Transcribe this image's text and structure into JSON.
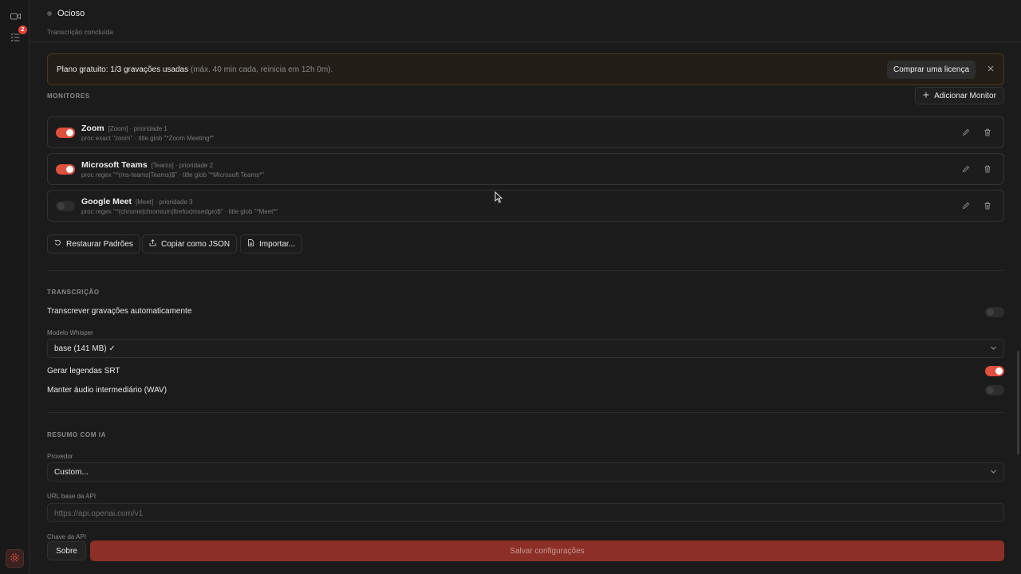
{
  "status": {
    "title": "Ocioso",
    "subtitle": "Transcrição concluída"
  },
  "sidebar": {
    "badge_count": "2",
    "accent": "#e0503e"
  },
  "banner": {
    "bold": "Plano gratuito: 1/3 gravações usadas",
    "muted": " (máx. 40 min cada, reinicia em 12h 0m).",
    "buy_label": "Comprar uma licença"
  },
  "monitors": {
    "section_label": "MONITORES",
    "add_label": "Adicionar Monitor",
    "items": [
      {
        "name": "Zoom",
        "meta": "[Zoom] · prioridade 1",
        "rule": "proc exact \"zoom\" · title glob \"*Zoom Meeting*\"",
        "enabled": true
      },
      {
        "name": "Microsoft Teams",
        "meta": "[Teams] · prioridade 2",
        "rule": "proc regex \"^(ms-teams|Teams)$\" · title glob \"*Microsoft Teams*\"",
        "enabled": true
      },
      {
        "name": "Google Meet",
        "meta": "[Meet] · prioridade 3",
        "rule": "proc regex \"^(chrome|chromium|firefox|msedge)$\" · title glob \"*Meet*\"",
        "enabled": false
      }
    ],
    "restore_label": "Restaurar Padrões",
    "copy_label": "Copiar como JSON",
    "import_label": "Importar..."
  },
  "transcription": {
    "section_label": "TRANSCRIÇÃO",
    "auto_label": "Transcrever gravações automaticamente",
    "auto_enabled": false,
    "model_label": "Modelo Whisper",
    "model_value": "base (141 MB) ✓",
    "srt_label": "Gerar legendas SRT",
    "srt_enabled": true,
    "wav_label": "Manter áudio intermediário (WAV)",
    "wav_enabled": false
  },
  "summary": {
    "section_label": "RESUMO COM IA",
    "provider_label": "Provedor",
    "provider_value": "Custom...",
    "url_label": "URL base da API",
    "url_placeholder": "https://api.openai.com/v1",
    "key_label": "Chave da API"
  },
  "footer": {
    "about_label": "Sobre",
    "save_label": "Salvar configurações"
  }
}
